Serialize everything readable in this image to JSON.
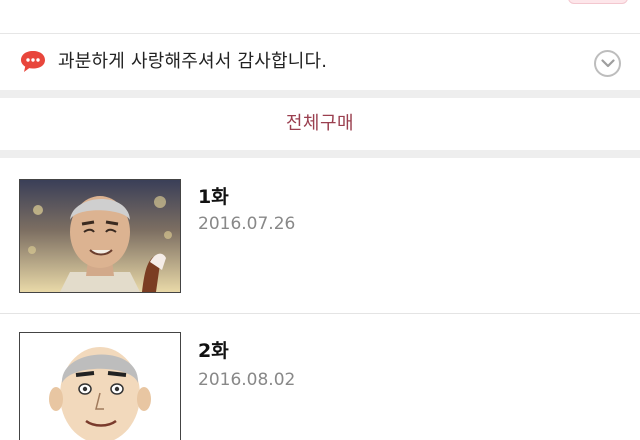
{
  "notice": {
    "icon": "speech-bubble-icon",
    "text": "과분하게 사랑해주셔서 감사합니다.",
    "toggle_icon": "chevron-down-icon",
    "accent_color": "#e8463c"
  },
  "purchase_all": {
    "label": "전체구매",
    "color": "#9a3f4f"
  },
  "episodes": [
    {
      "title": "1화",
      "date": "2016.07.26",
      "thumbnail": "episode-1-thumbnail"
    },
    {
      "title": "2화",
      "date": "2016.08.02",
      "thumbnail": "episode-2-thumbnail"
    }
  ]
}
